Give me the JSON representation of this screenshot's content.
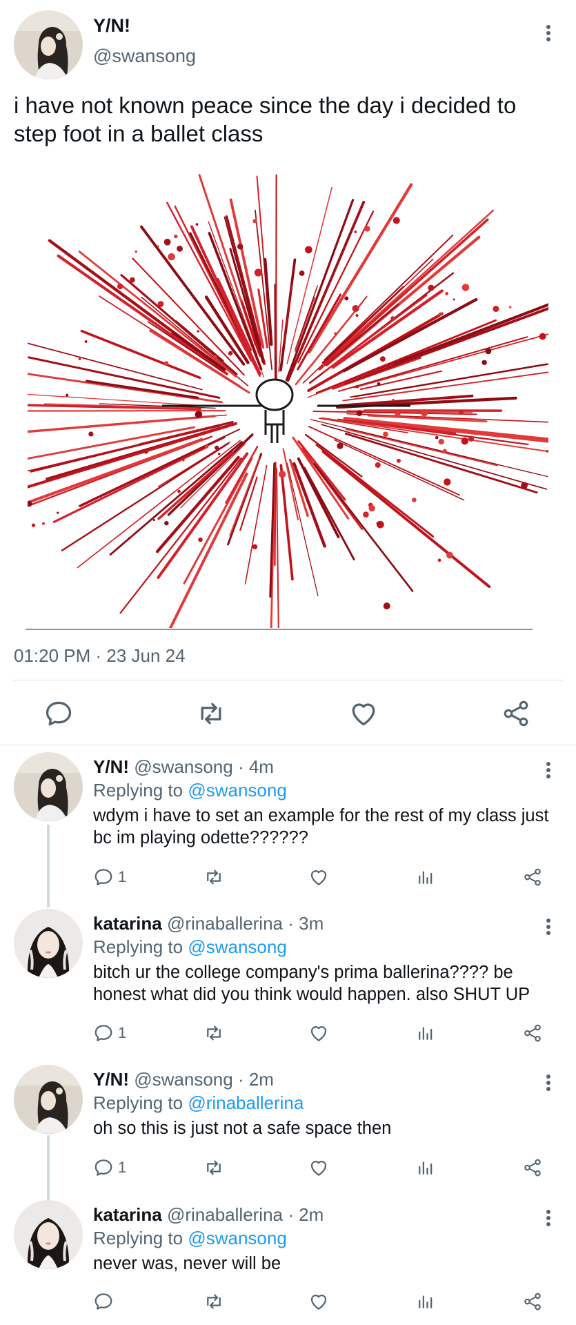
{
  "main_tweet": {
    "display_name": "Y/N!",
    "handle": "@swansong",
    "text": "i have not known peace since the day i decided to step foot in a ballet class",
    "timestamp": "01:20 PM · 23 Jun 24"
  },
  "icons": {
    "reply": "speech-bubble-icon",
    "retweet": "retweet-arrows-icon",
    "like": "heart-icon",
    "views": "bar-chart-icon",
    "share": "share-nodes-icon",
    "more": "vertical-dots-icon"
  },
  "colors": {
    "link": "#1d9bf0",
    "secondary_text": "#536471",
    "splatter": "#cc1a1a"
  },
  "replies": [
    {
      "display_name": "Y/N!",
      "handle": "@swansong",
      "time": " · 4m",
      "replying_label": "Replying to ",
      "replying_to": "@swansong",
      "text": "wdym i have to set an example for the rest of my class just bc im playing odette??????",
      "reply_count": "1"
    },
    {
      "display_name": "katarina",
      "handle": "@rinaballerina",
      "time": " · 3m",
      "replying_label": "Replying to ",
      "replying_to": "@swansong",
      "text": "bitch ur the college company's prima ballerina???? be honest what did you think would happen. also SHUT UP",
      "reply_count": "1"
    },
    {
      "display_name": "Y/N!",
      "handle": "@swansong",
      "time": " · 2m",
      "replying_label": "Replying to ",
      "replying_to": "@rinaballerina",
      "text": "oh so this is just not a safe space then",
      "reply_count": "1"
    },
    {
      "display_name": "katarina",
      "handle": "@rinaballerina",
      "time": " · 2m",
      "replying_label": "Replying to ",
      "replying_to": "@swansong",
      "text": "never was, never will be",
      "reply_count": ""
    }
  ]
}
